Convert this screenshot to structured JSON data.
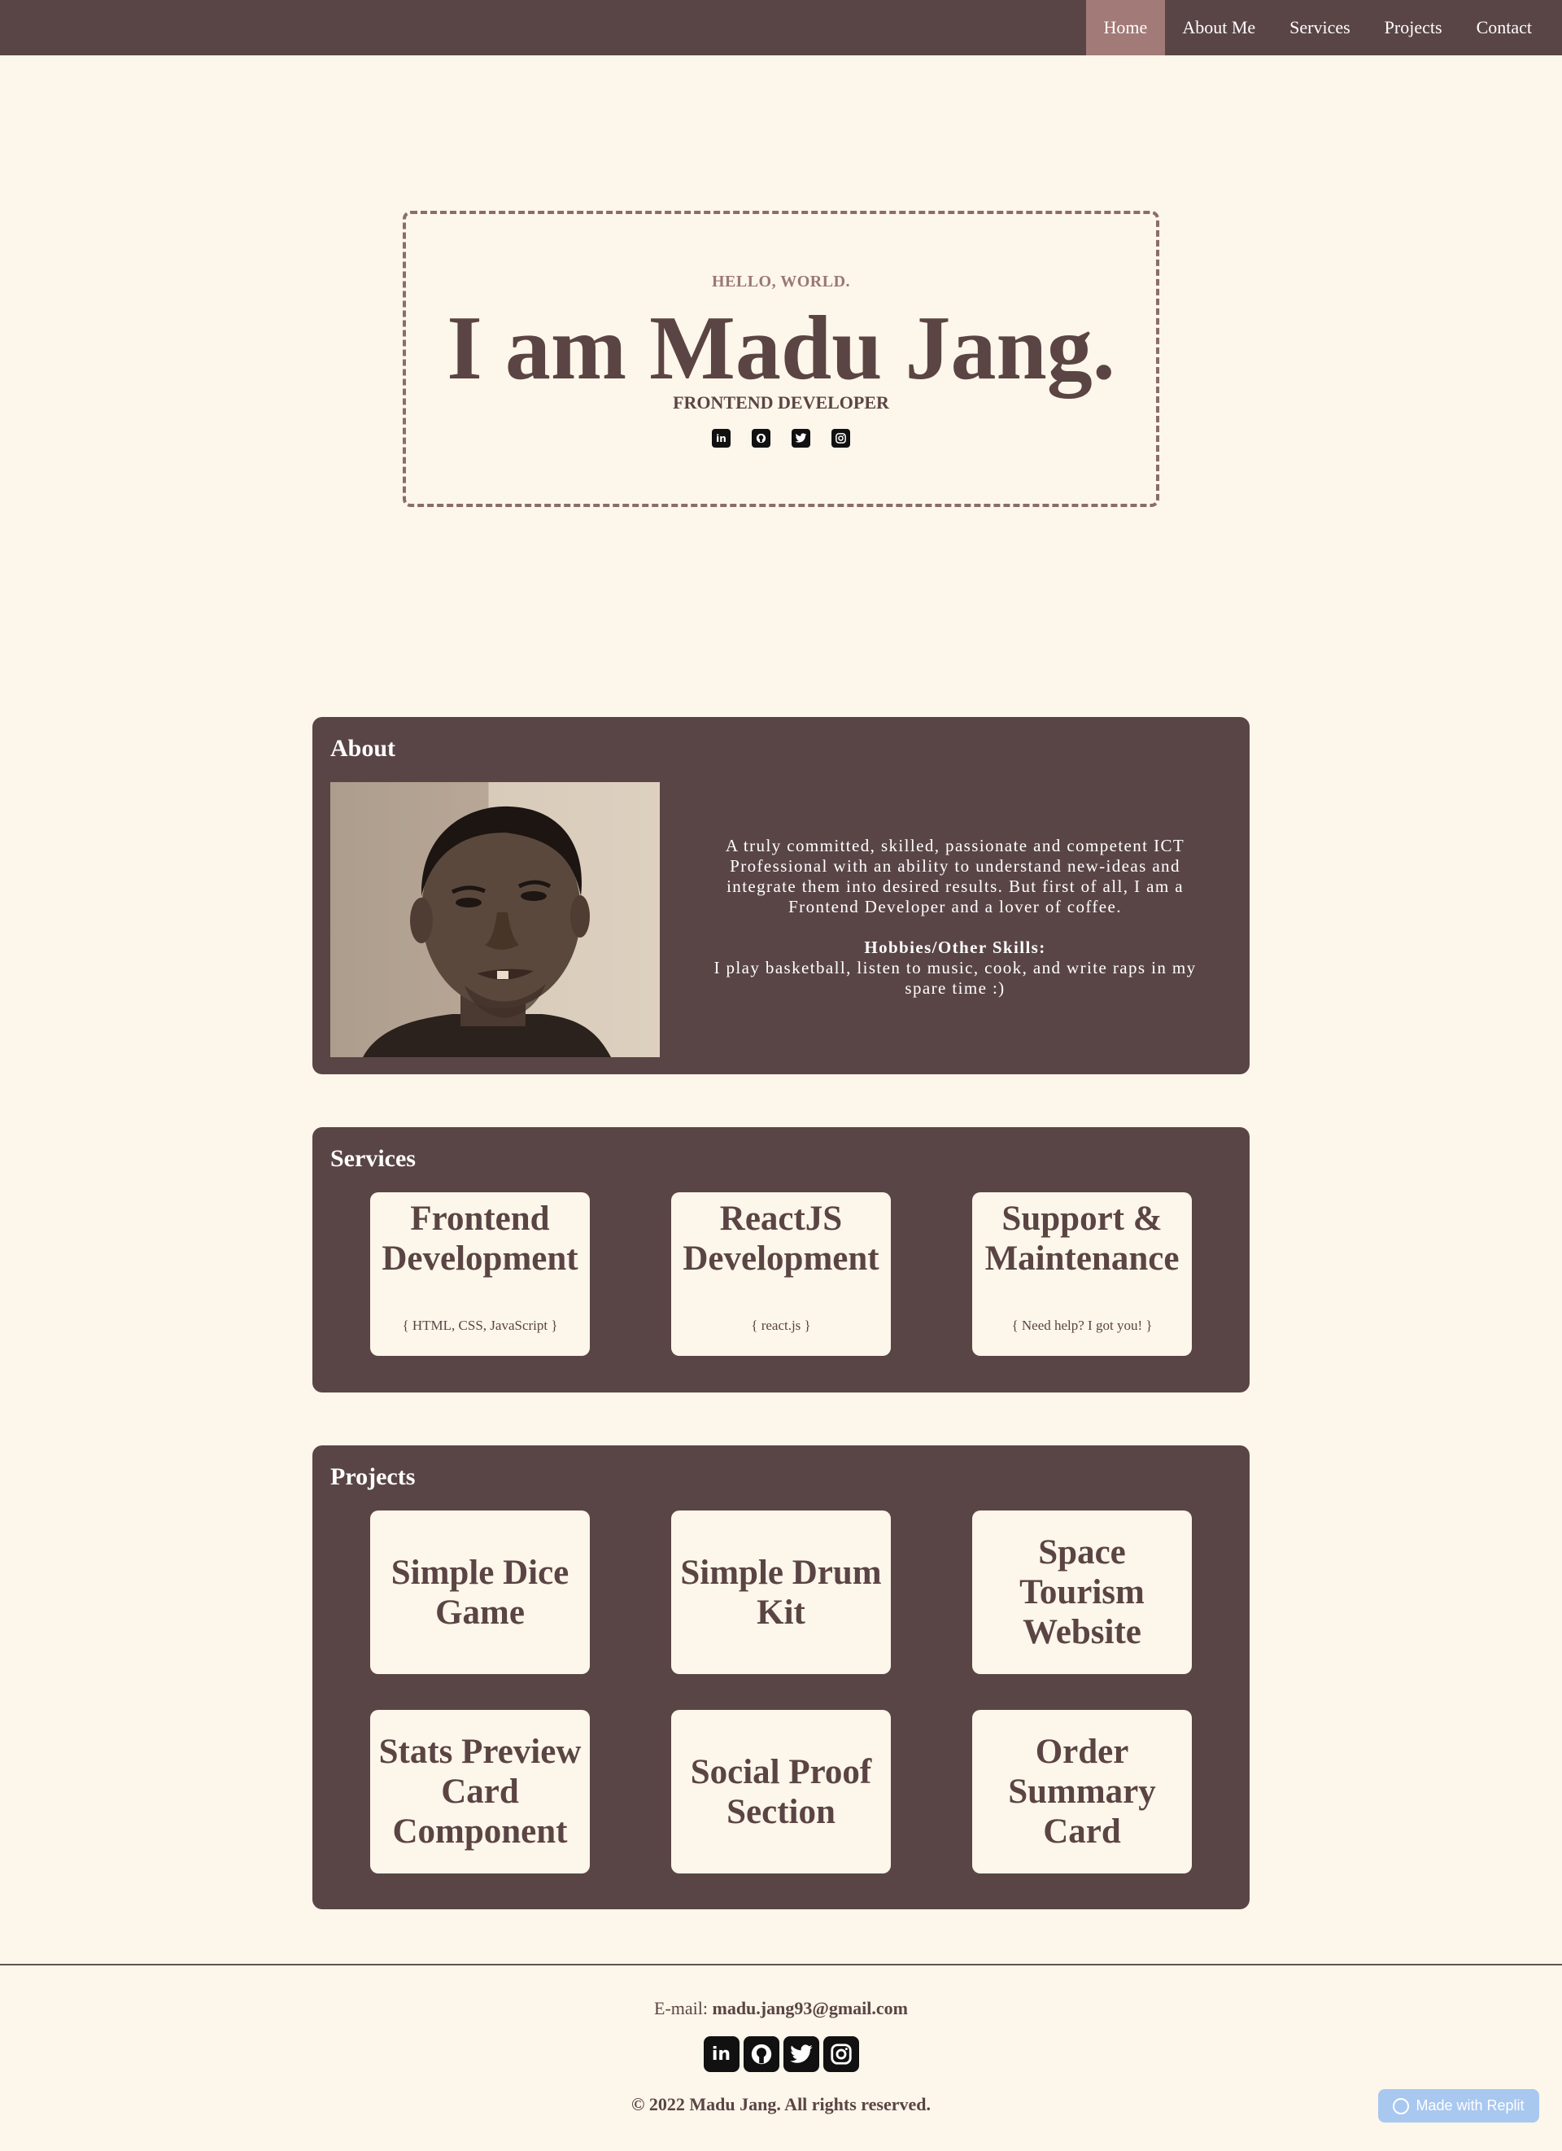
{
  "nav": {
    "items": [
      {
        "label": "Home",
        "active": true
      },
      {
        "label": "About Me",
        "active": false
      },
      {
        "label": "Services",
        "active": false
      },
      {
        "label": "Projects",
        "active": false
      },
      {
        "label": "Contact",
        "active": false
      }
    ]
  },
  "hero": {
    "greeting": "HELLO, WORLD.",
    "name": "I am Madu Jang.",
    "role": "FRONTEND DEVELOPER",
    "social_icons": [
      "linkedin-icon",
      "github-icon",
      "twitter-icon",
      "instagram-icon"
    ]
  },
  "about": {
    "title": "About",
    "bio": "A truly committed, skilled, passionate and competent ICT Professional with an ability to understand new-ideas and integrate them into desired results. But first of all, I am a Frontend Developer and a lover of coffee.",
    "hobbies_heading": "Hobbies/Other Skills:",
    "hobbies": "I play basketball, listen to music, cook, and write raps in my spare time :)"
  },
  "services": {
    "title": "Services",
    "items": [
      {
        "title": "Frontend Development",
        "sub": "{ HTML, CSS, JavaScript }"
      },
      {
        "title": "ReactJS Development",
        "sub": "{ react.js }"
      },
      {
        "title": "Support & Maintenance",
        "sub": "{ Need help? I got you! }"
      }
    ]
  },
  "projects": {
    "title": "Projects",
    "items": [
      "Simple Dice Game",
      "Simple Drum Kit",
      "Space Tourism Website",
      "Stats Preview Card Component",
      "Social Proof Section",
      "Order Summary Card"
    ]
  },
  "footer": {
    "email_label": "E-mail: ",
    "email": "madu.jang93@gmail.com",
    "copyright": "© 2022 Madu Jang. All rights reserved.",
    "badge": "Made with Replit"
  },
  "colors": {
    "background": "#fdf6ea",
    "panel": "#5a4546",
    "nav_active": "#a27a78",
    "text": "#5a4444"
  }
}
